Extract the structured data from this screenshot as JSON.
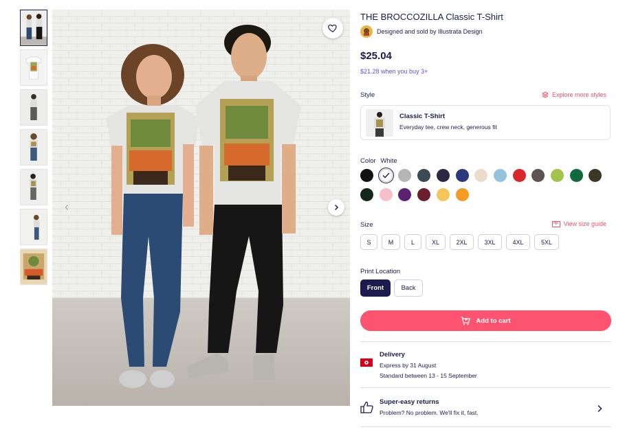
{
  "product": {
    "title": "THE BROCCOZILLA Classic T-Shirt",
    "seller": "Designed and sold by Illustrata Design",
    "price": "$25.04",
    "bulk_price": "$21.28 when you buy 3+"
  },
  "style": {
    "label": "Style",
    "explore_link": "Explore more styles",
    "card_name": "Classic T-Shirt",
    "card_desc": "Everyday tee, crew neck, generous fit"
  },
  "color": {
    "label": "Color",
    "selected": "White",
    "swatches": [
      "#111111",
      "#ffffff",
      "#b5b5b5",
      "#3b4a55",
      "#2a2740",
      "#2d3a7a",
      "#ecdccb",
      "#95c2dc",
      "#d9262a",
      "#5e5350",
      "#a3c44a",
      "#0f6b3f",
      "#3d3826",
      "#13281a",
      "#f6bfc9",
      "#5c2170",
      "#6b1f2e",
      "#f5c55a",
      "#f59a23"
    ]
  },
  "size": {
    "label": "Size",
    "guide_link": "View size guide",
    "options": [
      "S",
      "M",
      "L",
      "XL",
      "2XL",
      "3XL",
      "4XL",
      "5XL"
    ]
  },
  "print": {
    "label": "Print Location",
    "options": [
      "Front",
      "Back"
    ],
    "selected": "Front"
  },
  "cart": {
    "label": "Add to cart"
  },
  "delivery": {
    "title": "Delivery",
    "express": "Express by 31 August",
    "standard": "Standard between 13 - 15 September"
  },
  "returns": {
    "title": "Super-easy returns",
    "text": "Problem? No problem. We'll fix it, fast."
  },
  "icons": [
    "heart-icon",
    "chevron-right-icon",
    "chevron-left-icon",
    "layers-icon",
    "ruler-icon",
    "cart-icon",
    "hong-kong-flag-icon",
    "thumbs-up-icon",
    "check-icon"
  ]
}
